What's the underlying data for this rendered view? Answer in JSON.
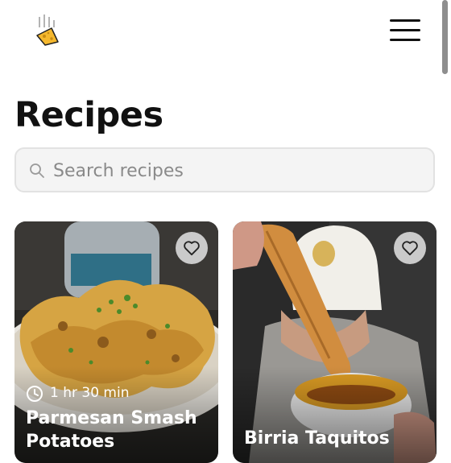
{
  "header": {
    "logo_icon": "cheese-wedge-logo",
    "menu_icon": "hamburger-menu-icon"
  },
  "page": {
    "title": "Recipes"
  },
  "search": {
    "placeholder": "Search recipes",
    "icon": "search-icon"
  },
  "recipes": [
    {
      "time": "1 hr 30 min",
      "title": "Parmesan Smash Potatoes",
      "favorite_icon": "heart-icon"
    },
    {
      "time": "",
      "title": "Birria Taquitos",
      "favorite_icon": "heart-icon"
    }
  ],
  "colors": {
    "accent_cheese": "#f5b82e",
    "text": "#111111",
    "search_bg": "#f4f4f4"
  }
}
